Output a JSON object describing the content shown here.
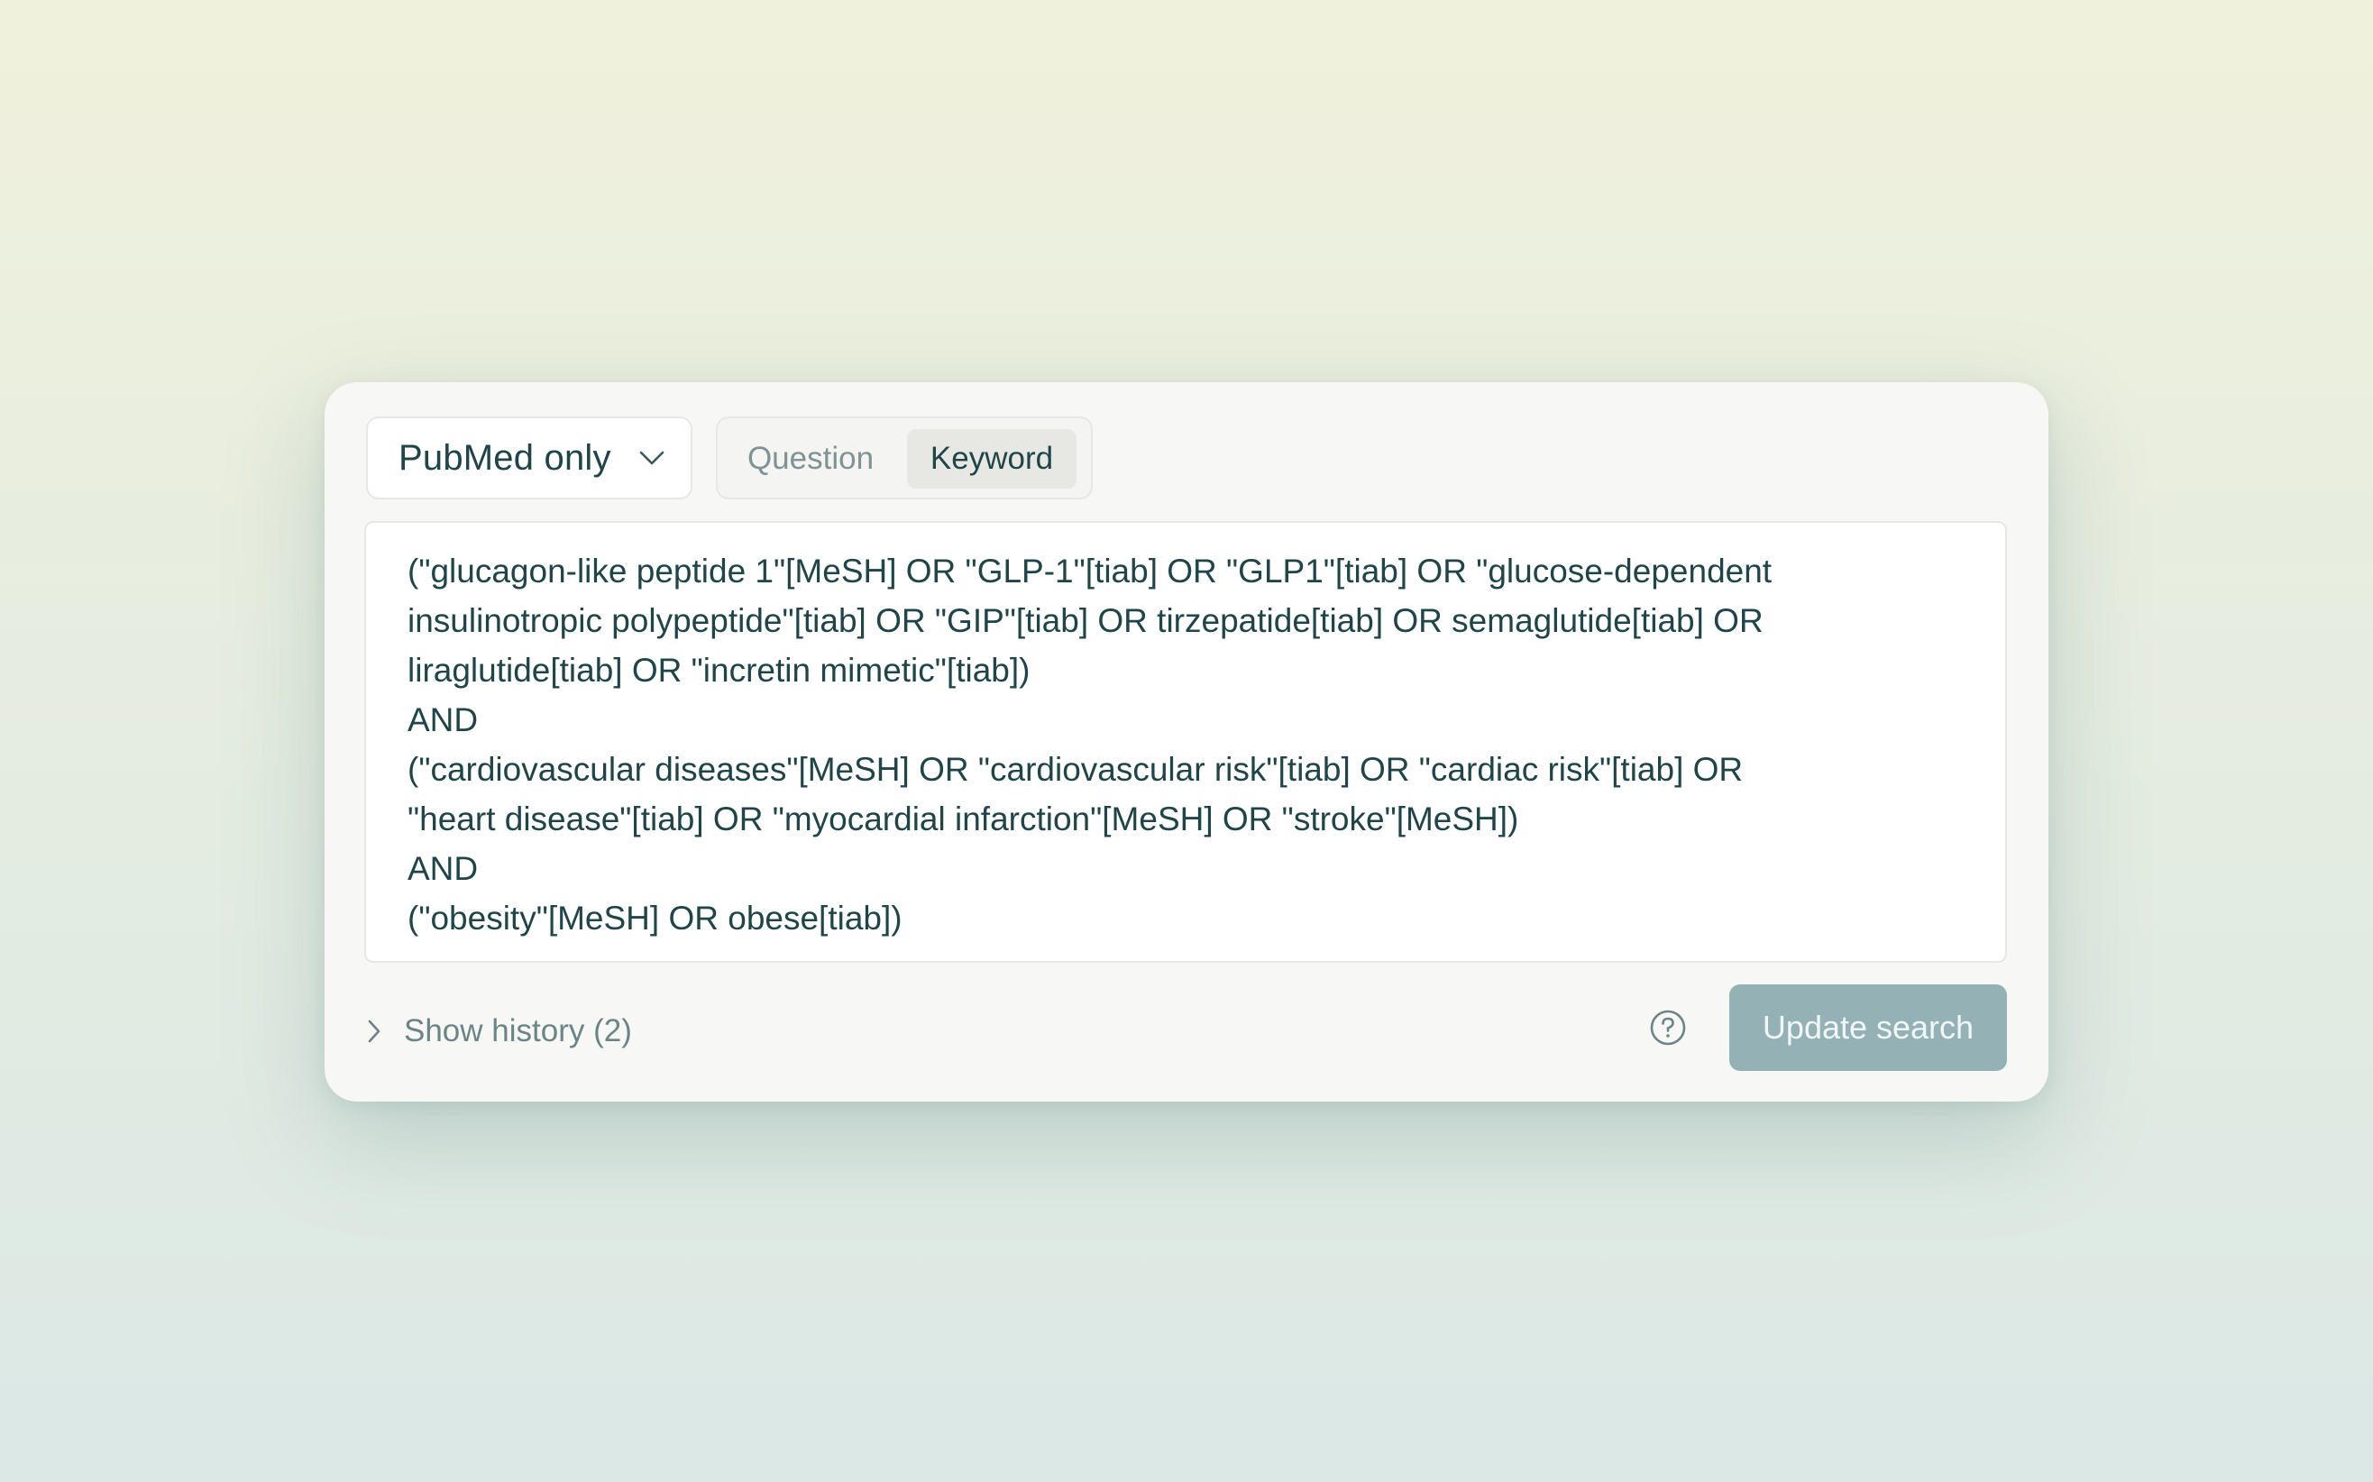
{
  "source_select": {
    "label": "PubMed only",
    "icon": "chevron-down-icon"
  },
  "mode_tabs": [
    {
      "label": "Question",
      "selected": false
    },
    {
      "label": "Keyword",
      "selected": true
    }
  ],
  "query": {
    "text": "(\"glucagon-like peptide 1\"[MeSH] OR \"GLP-1\"[tiab] OR \"GLP1\"[tiab] OR \"glucose-dependent\ninsulinotropic polypeptide\"[tiab] OR \"GIP\"[tiab] OR tirzepatide[tiab] OR semaglutide[tiab] OR\nliraglutide[tiab] OR \"incretin mimetic\"[tiab])\nAND\n(\"cardiovascular diseases\"[MeSH] OR \"cardiovascular risk\"[tiab] OR \"cardiac risk\"[tiab] OR\n\"heart disease\"[tiab] OR \"myocardial infarction\"[MeSH] OR \"stroke\"[MeSH])\nAND\n(\"obesity\"[MeSH] OR obese[tiab])"
  },
  "history": {
    "label": "Show history (2)",
    "icon": "chevron-right-icon"
  },
  "help": {
    "icon": "question-circle-icon"
  },
  "update_button": {
    "label": "Update search"
  },
  "colors": {
    "text_primary": "#1f4548",
    "text_muted": "#7f9394",
    "button_bg": "#94b2b5",
    "card_bg": "#f7f7f5"
  }
}
